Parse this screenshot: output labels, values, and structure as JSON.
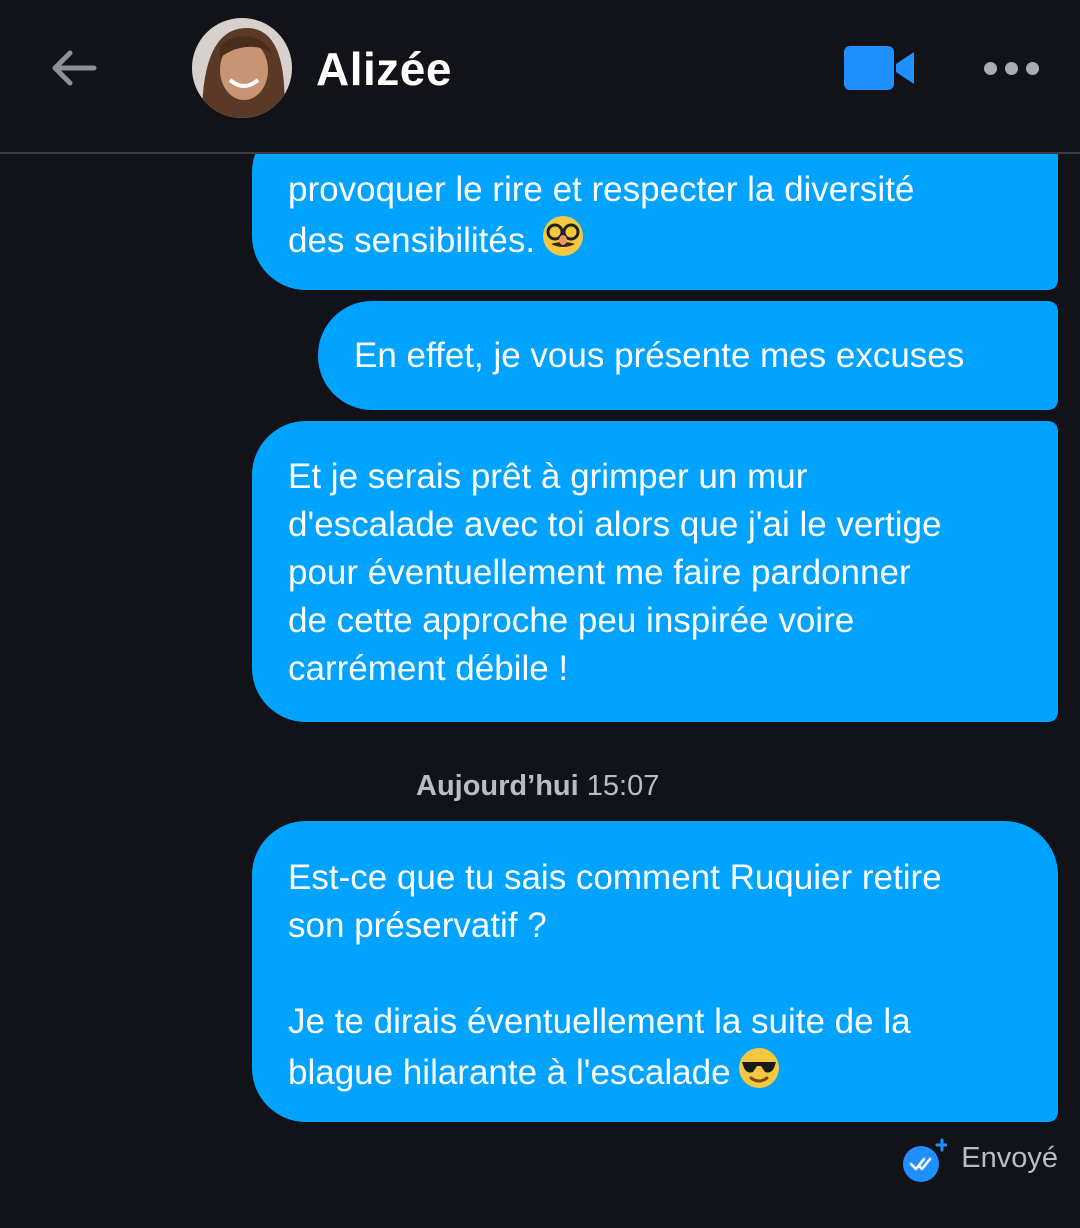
{
  "header": {
    "contact_name": "Alizée",
    "back_icon": "arrow-left-icon",
    "video_icon": "video-camera-icon",
    "more_icon": "more-dots-icon",
    "accent_color": "#1e90ff"
  },
  "messages": [
    {
      "text": "provoquer le rire et respecter la diversité\ndes sensibilités.",
      "emoji": "disguise-glasses"
    },
    {
      "text": "En effet, je vous présente mes excuses"
    },
    {
      "text": "Et je serais prêt à grimper un mur\nd'escalade avec toi alors que j'ai le vertige\npour éventuellement me faire pardonner\nde cette approche peu inspirée voire\ncarrément débile !"
    },
    {
      "text": "Est-ce que tu sais comment Ruquier retire\nson préservatif ?\n\nJe te dirais éventuellement la suite de la\nblague hilarante à l'escalade",
      "emoji": "sunglasses"
    }
  ],
  "timestamp": {
    "day": "Aujourd’hui",
    "time": "15:07"
  },
  "status": {
    "label": "Envoyé",
    "icon": "double-check-icon"
  },
  "colors": {
    "bubble": "#00a3ff",
    "background": "#111318"
  }
}
